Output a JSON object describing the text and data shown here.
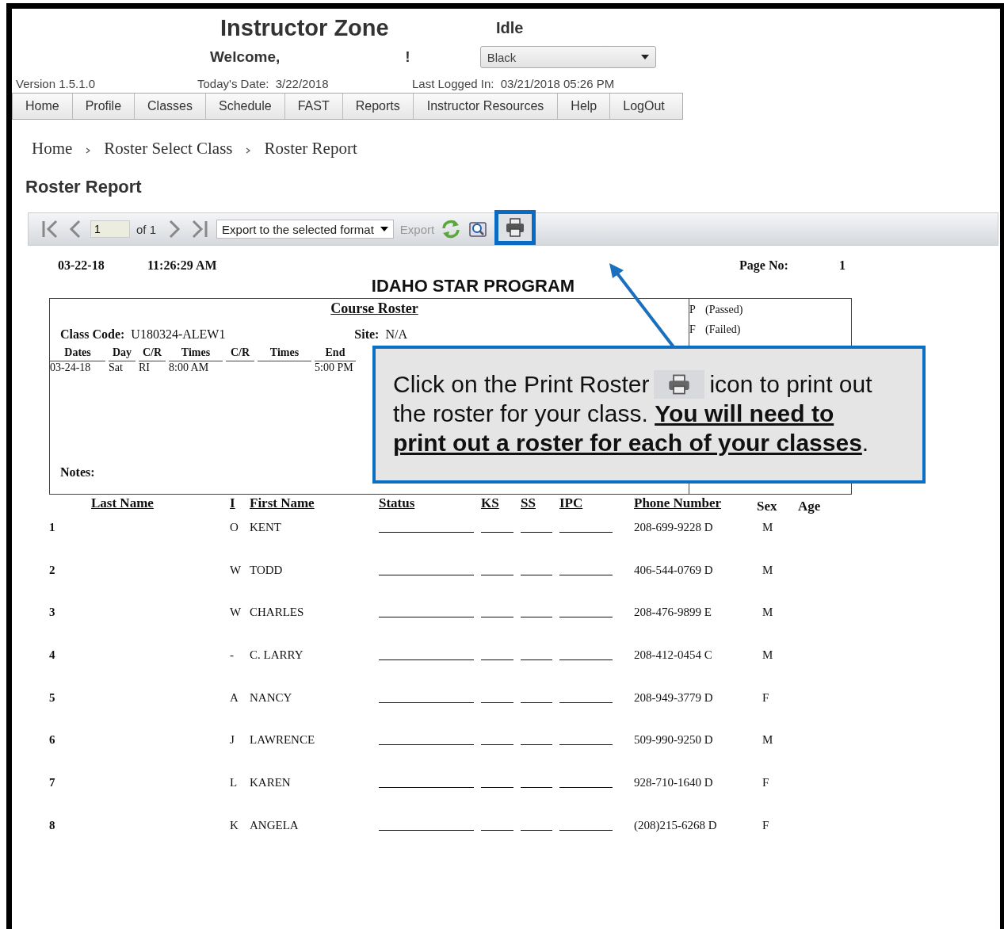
{
  "header": {
    "title": "Instructor Zone",
    "status": "Idle",
    "welcome": {
      "greeting": "Welcome,",
      "end": "!"
    },
    "theme_select": {
      "value": "Black"
    },
    "version": "Version 1.5.1.0",
    "todays_date": {
      "label": "Today's Date:",
      "value": "3/22/2018"
    },
    "last_logged_in": {
      "label": "Last Logged In:",
      "value": "03/21/2018 05:26 PM"
    }
  },
  "nav": [
    {
      "label": "Home"
    },
    {
      "label": "Profile"
    },
    {
      "label": "Classes"
    },
    {
      "label": "Schedule"
    },
    {
      "label": "FAST"
    },
    {
      "label": "Reports"
    },
    {
      "label": "Instructor Resources"
    },
    {
      "label": "Help"
    },
    {
      "label": "LogOut"
    }
  ],
  "breadcrumb": [
    "Home",
    "Roster Select Class",
    "Roster Report"
  ],
  "heading": "Roster Report",
  "toolbar": {
    "page_field": {
      "value": "1"
    },
    "page_of": "of 1",
    "export_select": {
      "value": "Export to the selected format"
    },
    "export_button": {
      "label": "Export",
      "disabled": true
    }
  },
  "report": {
    "date": "03-22-18",
    "time": "11:26:29 AM",
    "page_label": "Page No:",
    "page_number": "1",
    "title": "IDAHO STAR PROGRAM",
    "course_box": {
      "heading": "Course Roster",
      "class_code_label": "Class Code:",
      "class_code": "U180324-ALEW1",
      "site_label": "Site:",
      "site": "N/A",
      "schedule": [
        {
          "label": "Dates",
          "value": "03-24-18"
        },
        {
          "label": "Day",
          "value": "Sat"
        },
        {
          "label": "C/R",
          "value": "RI"
        },
        {
          "label": "Times",
          "value": "8:00 AM"
        },
        {
          "label": "C/R"
        },
        {
          "label": "Times"
        },
        {
          "label": "End",
          "value": "5:00 PM"
        }
      ],
      "notes_label": "Notes:",
      "legend": [
        {
          "code": "P",
          "text": "(Passed)"
        },
        {
          "code": "F",
          "text": "(Failed)"
        }
      ]
    },
    "columns": [
      {
        "label": "Last Name",
        "underlined": true
      },
      {
        "label": "I",
        "underlined": true
      },
      {
        "label": "First Name",
        "underlined": true
      },
      {
        "label": "Status",
        "underlined": true
      },
      {
        "label": "KS",
        "underlined": true
      },
      {
        "label": "SS",
        "underlined": true
      },
      {
        "label": "IPC",
        "underlined": true
      },
      {
        "label": "Phone Number",
        "underlined": true
      },
      {
        "label": "Sex",
        "underlined": false
      },
      {
        "label": "Age",
        "underlined": false
      }
    ],
    "rows": [
      {
        "number": "1",
        "initial": "O",
        "first_name": "KENT",
        "phone": "208-699-9228 D",
        "sex": "M"
      },
      {
        "number": "2",
        "initial": "W",
        "first_name": "TODD",
        "phone": "406-544-0769 D",
        "sex": "M"
      },
      {
        "number": "3",
        "initial": "W",
        "first_name": "CHARLES",
        "phone": "208-476-9899 E",
        "sex": "M"
      },
      {
        "number": "4",
        "initial": "-",
        "first_name": "C. LARRY",
        "phone": "208-412-0454 C",
        "sex": "M"
      },
      {
        "number": "5",
        "initial": "A",
        "first_name": "NANCY",
        "phone": "208-949-3779 D",
        "sex": "F"
      },
      {
        "number": "6",
        "initial": "J",
        "first_name": "LAWRENCE",
        "phone": "509-990-9250 D",
        "sex": "M"
      },
      {
        "number": "7",
        "initial": "L",
        "first_name": "KAREN",
        "phone": "928-710-1640 D",
        "sex": "F"
      },
      {
        "number": "8",
        "initial": "K",
        "first_name": "ANGELA",
        "phone": "(208)215-6268 D",
        "sex": "F"
      }
    ]
  },
  "callout": {
    "text_before": "Click on the Print Roster",
    "text_after": "icon to print out",
    "text_rest": "the roster for your class. **You will need to print out a roster for each of your classes**."
  }
}
